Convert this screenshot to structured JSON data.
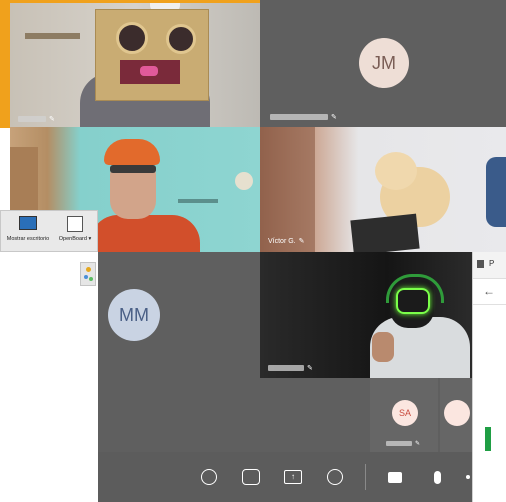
{
  "colors": {
    "accent_border": "#f0a11c",
    "tile_grey": "#5f5f5f",
    "toolbar_grey": "#5c5c5c",
    "avatar_jm_bg": "#eeded6",
    "avatar_jm_fg": "#7a5d55",
    "avatar_mm_bg": "#c9d3e3",
    "avatar_mm_fg": "#4a5f86",
    "avatar_sa_bg": "#fbe6e0",
    "avatar_sa_fg": "#c94b3e"
  },
  "participants": {
    "tile1": {
      "pin_icon": "pin-icon"
    },
    "jm": {
      "initials": "JM",
      "pin_icon": "pin-icon"
    },
    "tile3": {
      "pin_icon": "pin-icon"
    },
    "victor": {
      "name": "Víctor G.",
      "pin_icon": "pin-icon"
    },
    "mm": {
      "initials": "MM"
    },
    "tile6": {
      "pin_icon": "pin-icon"
    },
    "sa": {
      "initials": "SA"
    }
  },
  "desktop": {
    "show_desktop_label": "Mostrar escritorio",
    "openboard_label": "OpenBoard",
    "openboard_arrow": "▾"
  },
  "side_window": {
    "title_initial": "P"
  },
  "toolbar": {
    "icons": [
      "chat-icon",
      "participants-icon",
      "share-screen-icon",
      "raise-hand-icon",
      "camera-off-icon",
      "microphone-icon"
    ]
  }
}
